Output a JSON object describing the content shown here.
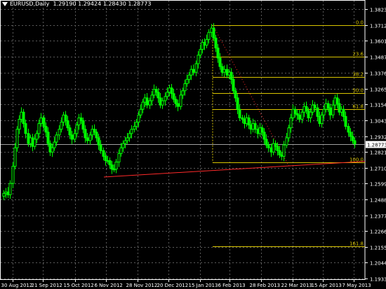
{
  "header": {
    "symbol_label": "EURUSD,Daily",
    "ohlc_text": "1.29190 1.29424 1.28430 1.28773"
  },
  "colors": {
    "background": "#000000",
    "grid": "#5a5a5a",
    "text": "#ffffff",
    "bull_candle": "#00ff00",
    "fib": "#d8c400",
    "trendline": "#ff2a2a",
    "current_price_line": "#a0a0a0"
  },
  "chart_data": {
    "type": "candlestick",
    "symbol": "EURUSD",
    "timeframe": "Daily",
    "last_ohlc": {
      "open": 1.2919,
      "high": 1.29424,
      "low": 1.2843,
      "close": 1.28773
    },
    "current_price_label": "1.28773",
    "y_ticks": [
      "1.38230",
      "1.37120",
      "1.36010",
      "1.34870",
      "1.33760",
      "1.32650",
      "1.31540",
      "1.30430",
      "1.29320",
      "1.28210",
      "1.27100",
      "1.25990",
      "1.24880",
      "1.23770",
      "1.22660",
      "1.21550",
      "1.20440",
      "1.19330"
    ],
    "ylim": [
      1.19,
      1.385
    ],
    "x_ticks": [
      "30 Aug 2012",
      "21 Sep 2012",
      "15 Oct 2012",
      "6 Nov 2012",
      "28 Nov 2012",
      "20 Dec 2012",
      "15 Jan 2013",
      "6 Feb 2013",
      "28 Feb 2013",
      "22 Mar 2013",
      "15 Apr 2013",
      "7 May 2013"
    ],
    "grid": true,
    "fib_levels": [
      {
        "label": "0.0",
        "price": 1.3712
      },
      {
        "label": "23.6",
        "price": 1.3487
      },
      {
        "label": "38.2",
        "price": 1.3348
      },
      {
        "label": "50.0",
        "price": 1.3235
      },
      {
        "label": "61.8",
        "price": 1.3123
      },
      {
        "label": "100.0",
        "price": 1.2748
      },
      {
        "label": "161.8",
        "price": 1.2158
      }
    ],
    "closes": [
      1.253,
      1.254,
      1.252,
      1.26,
      1.272,
      1.285,
      1.298,
      1.305,
      1.31,
      1.302,
      1.295,
      1.288,
      1.292,
      1.286,
      1.291,
      1.295,
      1.302,
      1.306,
      1.3,
      1.296,
      1.288,
      1.282,
      1.285,
      1.289,
      1.294,
      1.298,
      1.303,
      1.308,
      1.304,
      1.299,
      1.294,
      1.291,
      1.295,
      1.301,
      1.306,
      1.304,
      1.298,
      1.292,
      1.29,
      1.294,
      1.298,
      1.296,
      1.292,
      1.287,
      1.283,
      1.279,
      1.276,
      1.276,
      1.273,
      1.27,
      1.27,
      1.275,
      1.281,
      1.285,
      1.288,
      1.29,
      1.292,
      1.295,
      1.298,
      1.3,
      1.303,
      1.308,
      1.312,
      1.317,
      1.32,
      1.315,
      1.318,
      1.322,
      1.326,
      1.324,
      1.32,
      1.315,
      1.318,
      1.321,
      1.324,
      1.327,
      1.323,
      1.319,
      1.316,
      1.314,
      1.322,
      1.325,
      1.33,
      1.333,
      1.336,
      1.34,
      1.338,
      1.344,
      1.35,
      1.354,
      1.359,
      1.357,
      1.361,
      1.366,
      1.369,
      1.362,
      1.355,
      1.348,
      1.342,
      1.338,
      1.34,
      1.336,
      1.338,
      1.333,
      1.325,
      1.32,
      1.312,
      1.306,
      1.305,
      1.302,
      1.306,
      1.301,
      1.298,
      1.302,
      1.298,
      1.295,
      1.299,
      1.296,
      1.291,
      1.287,
      1.285,
      1.282,
      1.288,
      1.286,
      1.283,
      1.28,
      1.279,
      1.287,
      1.292,
      1.299,
      1.306,
      1.312,
      1.309,
      1.308,
      1.305,
      1.31,
      1.314,
      1.311,
      1.306,
      1.31,
      1.315,
      1.313,
      1.307,
      1.302,
      1.308,
      1.312,
      1.316,
      1.313,
      1.308,
      1.315,
      1.32,
      1.316,
      1.31,
      1.312,
      1.307,
      1.3,
      1.296,
      1.293,
      1.29,
      1.2877
    ]
  }
}
